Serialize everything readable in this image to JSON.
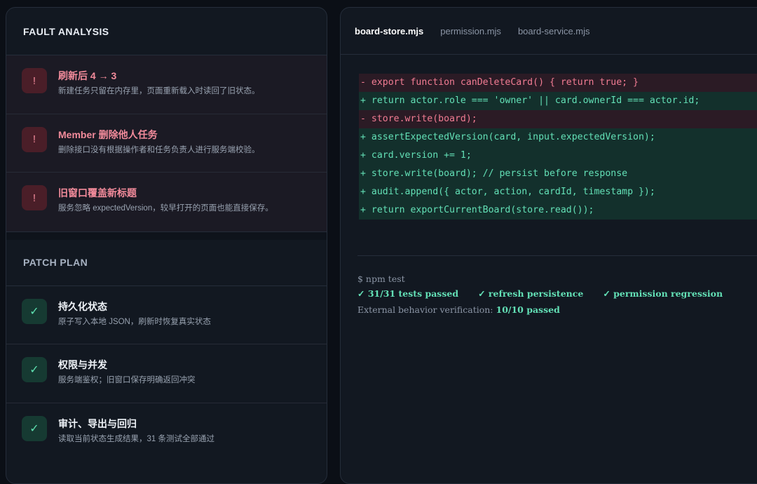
{
  "fault_analysis": {
    "title": "FAULT ANALYSIS",
    "items": [
      {
        "icon": "!",
        "title": "刷新后 4 → 3",
        "desc": "新建任务只留在内存里，页面重新载入时读回了旧状态。"
      },
      {
        "icon": "!",
        "title": "Member 删除他人任务",
        "desc": "删除接口没有根据操作者和任务负责人进行服务端校验。"
      },
      {
        "icon": "!",
        "title": "旧窗口覆盖新标题",
        "desc": "服务忽略 expectedVersion，较早打开的页面也能直接保存。"
      }
    ]
  },
  "patch_plan": {
    "title": "PATCH PLAN",
    "items": [
      {
        "icon": "✓",
        "title": "持久化状态",
        "desc": "原子写入本地 JSON，刷新时恢复真实状态"
      },
      {
        "icon": "✓",
        "title": "权限与并发",
        "desc": "服务端鉴权；旧窗口保存明确返回冲突"
      },
      {
        "icon": "✓",
        "title": "审计、导出与回归",
        "desc": "读取当前状态生成结果，31 条测试全部通过"
      }
    ]
  },
  "tabs": [
    "board-store.mjs",
    "permission.mjs",
    "board-service.mjs"
  ],
  "active_tab": "board-store.mjs",
  "diff_lines": [
    {
      "type": "del",
      "text": "- export function canDeleteCard() { return true; }"
    },
    {
      "type": "add",
      "text": "+ return actor.role === 'owner' || card.ownerId === actor.id;"
    },
    {
      "type": "del",
      "text": "- store.write(board);"
    },
    {
      "type": "add",
      "text": "+ assertExpectedVersion(card, input.expectedVersion);"
    },
    {
      "type": "add",
      "text": "+ card.version += 1;"
    },
    {
      "type": "add",
      "text": "+ store.write(board); // persist before response"
    },
    {
      "type": "add",
      "text": "+ audit.append({ actor, action, cardId, timestamp });"
    },
    {
      "type": "add",
      "text": "+ return exportCurrentBoard(store.read());"
    }
  ],
  "terminal": {
    "command": "$ npm test",
    "results": [
      "✓ 31/31 tests passed",
      "✓ refresh persistence",
      "✓ permission regression"
    ],
    "verify_label": "External behavior verification:",
    "verify_value": "10/10 passed"
  },
  "colors": {
    "delete": "#f27c93",
    "add": "#63e0b6",
    "fault_badge": "#4a1e28",
    "ok_badge": "#163a32"
  }
}
